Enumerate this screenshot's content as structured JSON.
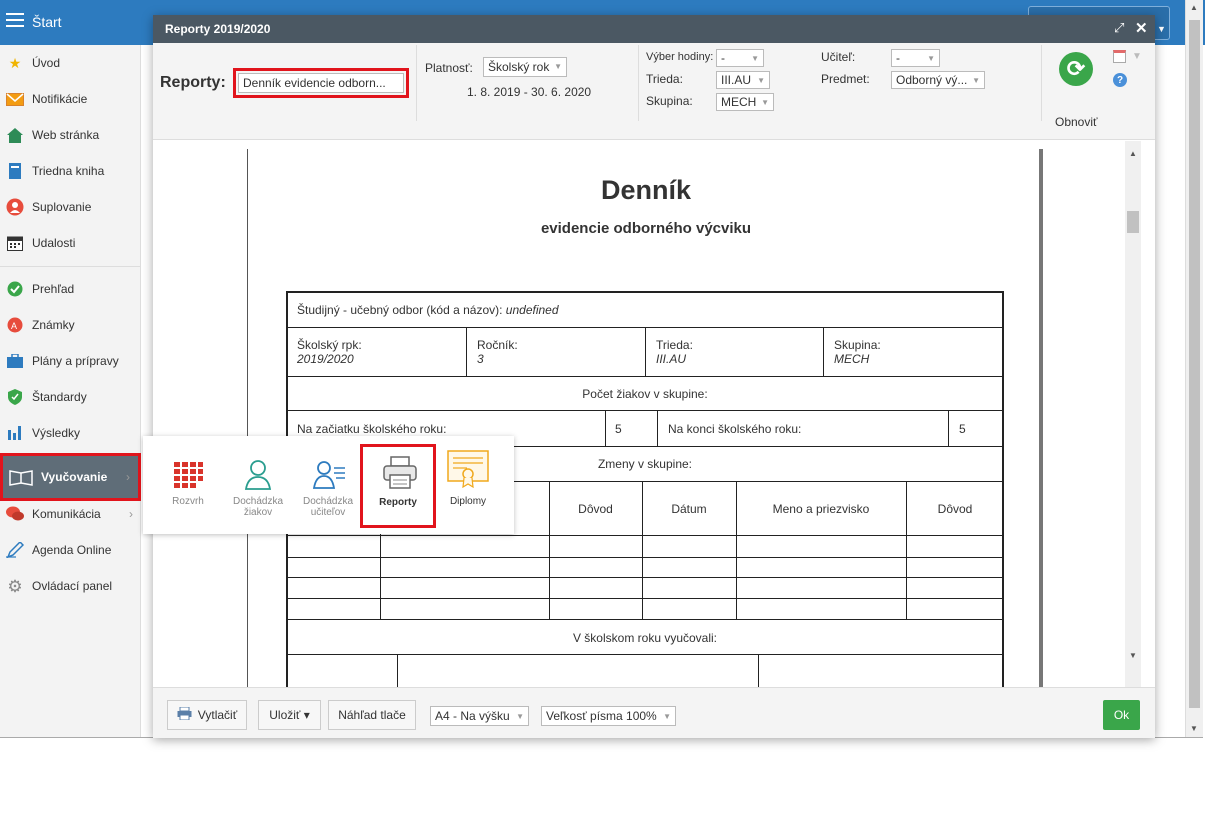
{
  "topbar": {
    "start_label": "Štart"
  },
  "sidebar": {
    "items": [
      {
        "label": "Úvod",
        "icon": "star-icon"
      },
      {
        "label": "Notifikácie",
        "icon": "envelope-icon"
      },
      {
        "label": "Web stránka",
        "icon": "home-icon"
      },
      {
        "label": "Triedna kniha",
        "icon": "book-icon"
      },
      {
        "label": "Suplovanie",
        "icon": "person-icon"
      },
      {
        "label": "Udalosti",
        "icon": "calendar-icon"
      },
      {
        "label": "Prehľad",
        "icon": "check-circle-icon"
      },
      {
        "label": "Známky",
        "icon": "grade-icon"
      },
      {
        "label": "Plány a prípravy",
        "icon": "briefcase-icon"
      },
      {
        "label": "Štandardy",
        "icon": "shield-icon"
      },
      {
        "label": "Výsledky",
        "icon": "bar-chart-icon"
      },
      {
        "label": "Vyučovanie",
        "icon": "open-book-icon"
      },
      {
        "label": "Komunikácia",
        "icon": "chat-icon"
      },
      {
        "label": "Agenda Online",
        "icon": "pen-icon"
      },
      {
        "label": "Ovládací panel",
        "icon": "gear-icon"
      }
    ]
  },
  "dialog": {
    "title": "Reporty 2019/2020",
    "toolbar": {
      "reports_label": "Reporty:",
      "reports_value": "Denník evidencie odborn...",
      "platnost_label": "Platnosť:",
      "platnost_value": "Školský rok",
      "date_range": "1. 8. 2019 - 30. 6. 2020",
      "vyber_hodiny_label": "Výber hodiny:",
      "vyber_hodiny_value": "-",
      "trieda_label": "Trieda:",
      "trieda_value": "III.AU",
      "skupina_label": "Skupina:",
      "skupina_value": "MECH",
      "ucitel_label": "Učiteľ:",
      "ucitel_value": "-",
      "predmet_label": "Predmet:",
      "predmet_value": "Odborný vý...",
      "refresh_label": "Obnoviť"
    },
    "document": {
      "title": "Denník",
      "subtitle": "evidencie odborného výcviku",
      "odbor_label": "Študijný - učebný odbor (kód a názov):",
      "odbor_value": "undefined",
      "skolsky_rok_label": "Školský rpk:",
      "skolsky_rok_value": "2019/2020",
      "rocnik_label": "Ročník:",
      "rocnik_value": "3",
      "trieda_label": "Trieda:",
      "trieda_value": "III.AU",
      "skupina_label": "Skupina:",
      "skupina_value": "MECH",
      "pocet_label": "Počet žiakov v skupine:",
      "zaciatok_label": "Na začiatku školského roku:",
      "zaciatok_value": "5",
      "koniec_label": "Na konci školského roku:",
      "koniec_value": "5",
      "zmeny_label": "Zmeny v skupine:",
      "col_dovod1": "Dôvod",
      "col_datum": "Dátum",
      "col_meno": "Meno a priezvisko",
      "col_dovod2": "Dôvod",
      "vyucovali_label": "V školskom roku vyučovali:"
    },
    "footer": {
      "print_label": "Vytlačiť",
      "save_label": "Uložiť ▾",
      "preview_label": "Náhľad tlače",
      "paper_value": "A4 - Na výšku",
      "font_value": "Veľkosť písma 100%",
      "ok_label": "Ok"
    }
  },
  "popup": {
    "items": [
      {
        "label": "Rozvrh",
        "icon": "grid-icon"
      },
      {
        "label": "Dochádzka žiakov",
        "icon": "student-icon"
      },
      {
        "label": "Dochádzka učiteľov",
        "icon": "teacher-list-icon"
      },
      {
        "label": "Reporty",
        "icon": "printer-icon"
      },
      {
        "label": "Diplomy",
        "icon": "diploma-icon"
      }
    ]
  }
}
